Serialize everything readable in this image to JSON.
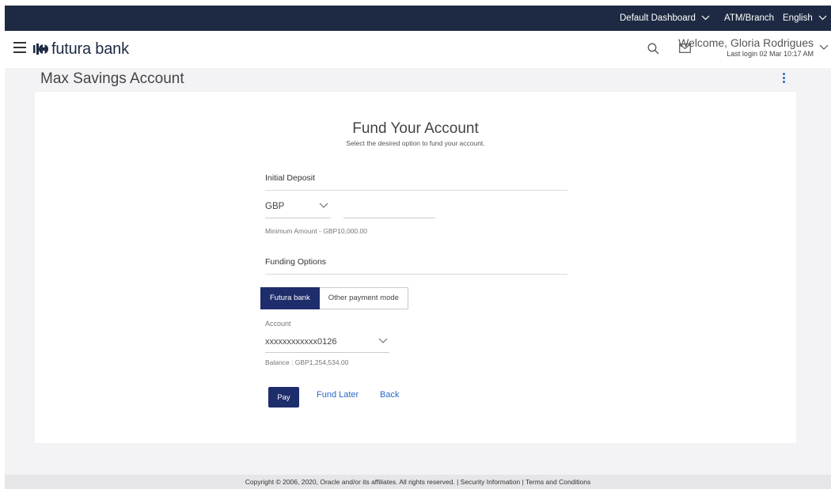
{
  "topbar": {
    "dashboard": "Default Dashboard",
    "atm_branch": "ATM/Branch",
    "language": "English"
  },
  "header": {
    "logo_text": "futura bank",
    "welcome": "Welcome, Gloria Rodrigues",
    "last_login": "Last login 02 Mar 10:17 AM",
    "icons": [
      "menu-icon",
      "search-icon",
      "mail-icon",
      "chevron-down-icon"
    ]
  },
  "page": {
    "title": "Max Savings Account"
  },
  "form": {
    "title": "Fund Your Account",
    "subtitle": "Select the desired option to fund your account.",
    "initial_deposit_label": "Initial Deposit",
    "currency": "GBP",
    "amount_value": "",
    "minimum_amount": "Minimum Amount - GBP10,000.00",
    "funding_options_label": "Funding Options",
    "tabs": [
      {
        "label": "Futura bank",
        "active": true
      },
      {
        "label": "Other payment mode",
        "active": false
      }
    ],
    "account_label": "Account",
    "account_value": "xxxxxxxxxxxx0126",
    "balance": "Balance : GBP1,254,534.00",
    "pay_label": "Pay",
    "fund_later_label": "Fund Later",
    "back_label": "Back"
  },
  "footer": {
    "text": "Copyright © 2006, 2020, Oracle and/or its affiliates. All rights reserved. | Security Information | Terms and Conditions"
  },
  "colors": {
    "topbar": "#1e2a43",
    "primary_button": "#1e2d6b",
    "link": "#2b67c9",
    "background": "#f3f3f5"
  }
}
